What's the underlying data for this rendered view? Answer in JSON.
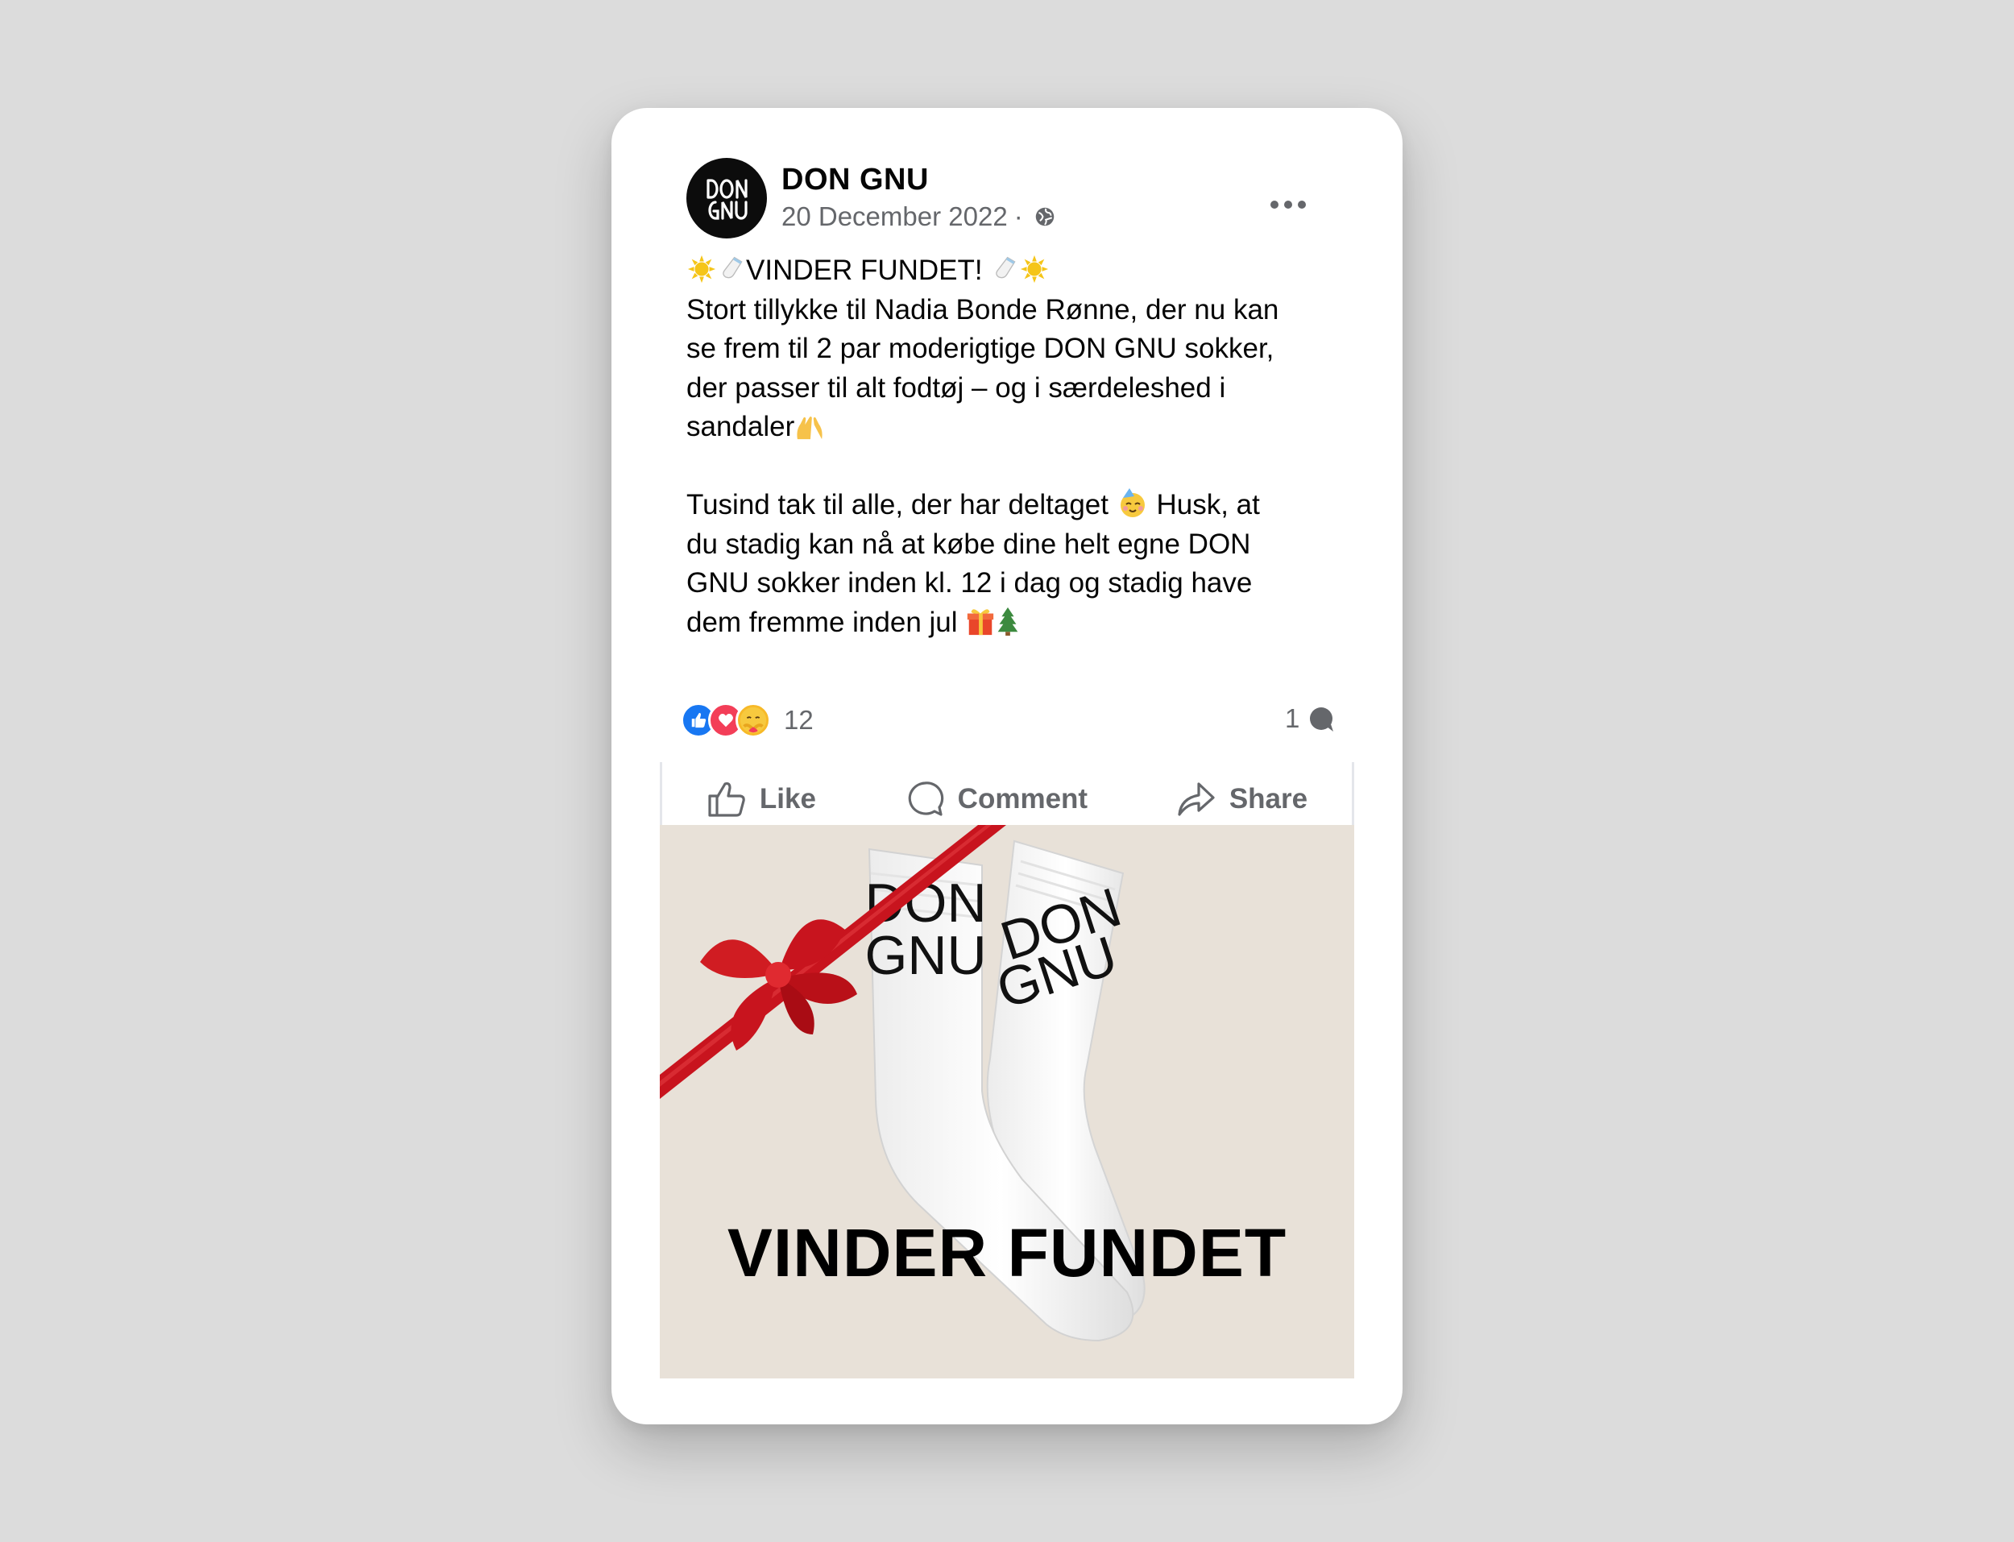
{
  "post": {
    "author": "DON GNU",
    "date": "20 December 2022",
    "separator": "·",
    "privacy_icon": "globe-icon",
    "avatar_text": "DON GNU",
    "title_line": "VINDER FUNDET!",
    "lines_para1": [
      "Stort tillykke til Nadia Bonde Rønne, der nu kan",
      "se frem til 2 par moderigtige DON GNU sokker,",
      "der passer til alt fodtøj – og i særdeleshed i",
      "sandaler"
    ],
    "lines_para2": [
      "Tusind tak til alle, der har deltaget",
      "Husk, at",
      "du stadig kan nå at købe dine helt egne DON",
      "GNU sokker inden kl. 12 i dag og stadig have",
      "dem fremme inden jul"
    ],
    "reaction_count": "12",
    "comment_count": "1",
    "actions": {
      "like": "Like",
      "comment": "Comment",
      "share": "Share"
    },
    "image": {
      "overlay_text": "VINDER FUNDET",
      "sock_logo_text": "DON GNU"
    }
  },
  "colors": {
    "background": "#dcdcdc",
    "card": "#ffffff",
    "text": "#050505",
    "muted": "#65676b",
    "like_blue": "#1877f2",
    "love_red": "#f33e58",
    "ribbon_red": "#c8141e",
    "photo_bg": "#e8e1d8"
  }
}
